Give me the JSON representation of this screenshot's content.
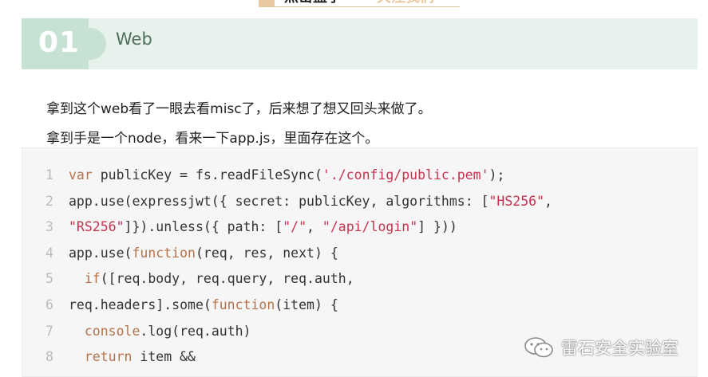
{
  "banner": {
    "left_text": "点击蓝字",
    "right_text": "关注我们"
  },
  "section": {
    "number": "01",
    "title": "Web"
  },
  "paragraphs": [
    "拿到这个web看了一眼去看misc了，后来想了想又回头来做了。",
    "拿到手是一个node，看来一下app.js，里面存在这个。"
  ],
  "code_lines": [
    {
      "n": "1",
      "tokens": [
        {
          "t": "var",
          "c": "kw"
        },
        {
          "t": " publicKey = fs.readFileSync(",
          "c": ""
        },
        {
          "t": "'./config/public.pem'",
          "c": "str"
        },
        {
          "t": ");",
          "c": ""
        }
      ]
    },
    {
      "n": "2",
      "tokens": [
        {
          "t": "app.use(expressjwt({ secret: publicKey, algorithms: [",
          "c": ""
        },
        {
          "t": "\"HS256\"",
          "c": "str"
        },
        {
          "t": ",",
          "c": ""
        }
      ]
    },
    {
      "n": "3",
      "tokens": [
        {
          "t": "\"RS256\"",
          "c": "str"
        },
        {
          "t": "]}).unless({ path: [",
          "c": ""
        },
        {
          "t": "\"/\"",
          "c": "str"
        },
        {
          "t": ", ",
          "c": ""
        },
        {
          "t": "\"/api/login\"",
          "c": "str"
        },
        {
          "t": "] }))",
          "c": ""
        }
      ]
    },
    {
      "n": "4",
      "tokens": [
        {
          "t": "app.use(",
          "c": ""
        },
        {
          "t": "function",
          "c": "kw"
        },
        {
          "t": "(req, res, next) {",
          "c": ""
        }
      ]
    },
    {
      "n": "5",
      "tokens": [
        {
          "t": "  ",
          "c": ""
        },
        {
          "t": "if",
          "c": "kw"
        },
        {
          "t": "([req.body, req.query, req.auth,",
          "c": ""
        }
      ]
    },
    {
      "n": "6",
      "tokens": [
        {
          "t": "req.headers].some(",
          "c": ""
        },
        {
          "t": "function",
          "c": "kw"
        },
        {
          "t": "(item) {",
          "c": ""
        }
      ]
    },
    {
      "n": "7",
      "tokens": [
        {
          "t": "  ",
          "c": ""
        },
        {
          "t": "console",
          "c": "kw"
        },
        {
          "t": ".log(req.auth)",
          "c": ""
        }
      ]
    },
    {
      "n": "8",
      "tokens": [
        {
          "t": "  ",
          "c": ""
        },
        {
          "t": "return",
          "c": "kw"
        },
        {
          "t": " item &&",
          "c": ""
        }
      ]
    }
  ],
  "watermark": {
    "text": "雷石安全实验室",
    "icon": "wechat-icon"
  }
}
